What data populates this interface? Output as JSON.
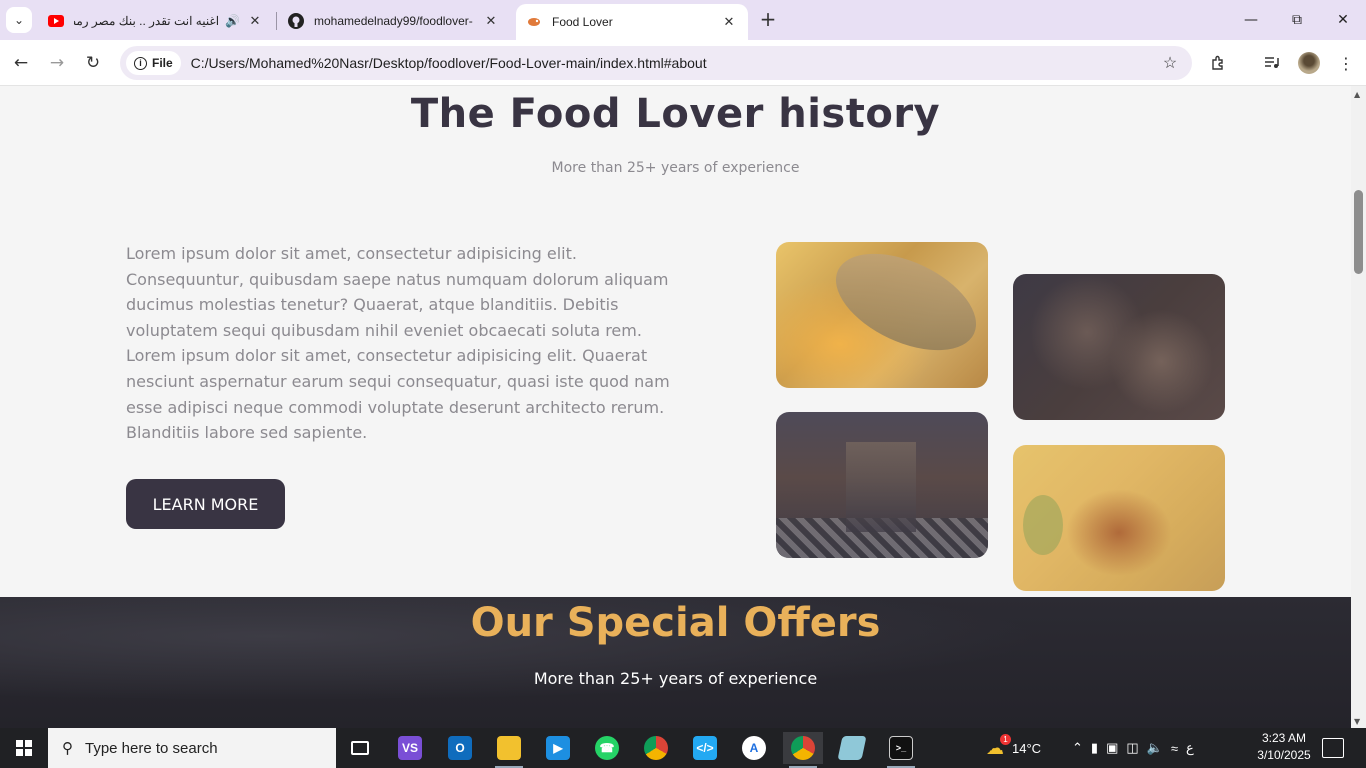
{
  "browser": {
    "tabs": [
      {
        "title": "اغنيه انت تقدر .. بنك مصر رمضان",
        "icon": "youtube-icon",
        "playing_audio": true
      },
      {
        "title": "mohamedelnady99/foodlover-",
        "icon": "github-icon",
        "playing_audio": false
      },
      {
        "title": "Food Lover",
        "icon": "food-lover-icon",
        "active": true
      }
    ],
    "scheme_chip": "File",
    "url": "C:/Users/Mohamed%20Nasr/Desktop/foodlover/Food-Lover-main/index.html#about"
  },
  "page": {
    "about": {
      "title": "The Food Lover history",
      "subtitle": "More than 25+ years of experience",
      "paragraph_1": "Lorem ipsum dolor sit amet, consectetur adipisicing elit. Consequuntur, quibusdam saepe natus numquam dolorum aliquam ducimus molestias tenetur? Quaerat, atque blanditiis. Debitis voluptatem sequi quibusdam nihil eveniet obcaecati soluta rem.",
      "paragraph_2": "Lorem ipsum dolor sit amet, consectetur adipisicing elit. Quaerat nesciunt aspernatur earum sequi consequatur, quasi iste quod nam esse adipisci neque commodi voluptate deserunt architecto rerum. Blanditiis labore sed sapiente.",
      "button_label": "LEARN MORE"
    },
    "offers": {
      "title": "Our Special Offers",
      "subtitle": "More than 25+ years of experience"
    },
    "colors": {
      "dark": "#393443",
      "accent": "#e9b15a",
      "muted_text": "#8c8a90"
    }
  },
  "taskbar": {
    "search_placeholder": "Type here to search",
    "weather_temp": "14°C",
    "weather_badge": "1",
    "input_language": "ع",
    "time": "3:23 AM",
    "date": "3/10/2025"
  }
}
